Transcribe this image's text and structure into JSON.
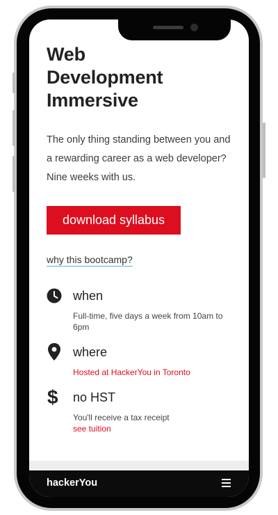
{
  "page": {
    "title_lines": [
      "Web",
      "Development",
      "Immersive"
    ],
    "intro": "The only thing standing between you and a rewarding career as a web developer? Nine weeks with us.",
    "cta_label": "download syllabus",
    "why_link": "why this bootcamp?"
  },
  "details": [
    {
      "icon": "clock-icon",
      "title": "when",
      "text": "Full-time, five days a week from 10am to 6pm"
    },
    {
      "icon": "map-pin-icon",
      "title": "where",
      "text": "Hosted at HackerYou in Toronto"
    },
    {
      "icon": "dollar-icon",
      "icon_glyph": "$",
      "title": "no HST",
      "text": "You'll receive a tax receipt",
      "link": "see tuition"
    }
  ],
  "footer": {
    "brand": "hackerYou",
    "menu_icon": "hamburger-menu-icon"
  },
  "colors": {
    "accent": "#dd0e1e",
    "link_underline": "#58b5d6",
    "text": "#222222",
    "footer": "#0c0c0c"
  }
}
